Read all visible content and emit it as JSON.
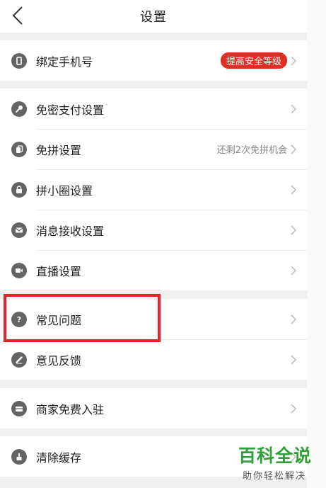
{
  "header": {
    "title": "设置"
  },
  "groups": {
    "phone": {
      "label": "绑定手机号",
      "badge": "提高安全等级"
    },
    "main": [
      {
        "label": "免密支付设置",
        "sub": ""
      },
      {
        "label": "免拼设置",
        "sub": "还剩2次免拼机会"
      },
      {
        "label": "拼小圈设置",
        "sub": ""
      },
      {
        "label": "消息接收设置",
        "sub": ""
      },
      {
        "label": "直播设置",
        "sub": ""
      }
    ],
    "help": [
      {
        "label": "常见问题"
      },
      {
        "label": "意见反馈"
      }
    ],
    "merchant": {
      "label": "商家免费入驻"
    },
    "cache": {
      "label": "清除缓存"
    }
  },
  "watermark": {
    "main": "百科全说",
    "sub": "助你轻松解决"
  },
  "colors": {
    "accent": "#e02e24",
    "highlight": "#e8202a",
    "watermark": "#2f9e36"
  }
}
